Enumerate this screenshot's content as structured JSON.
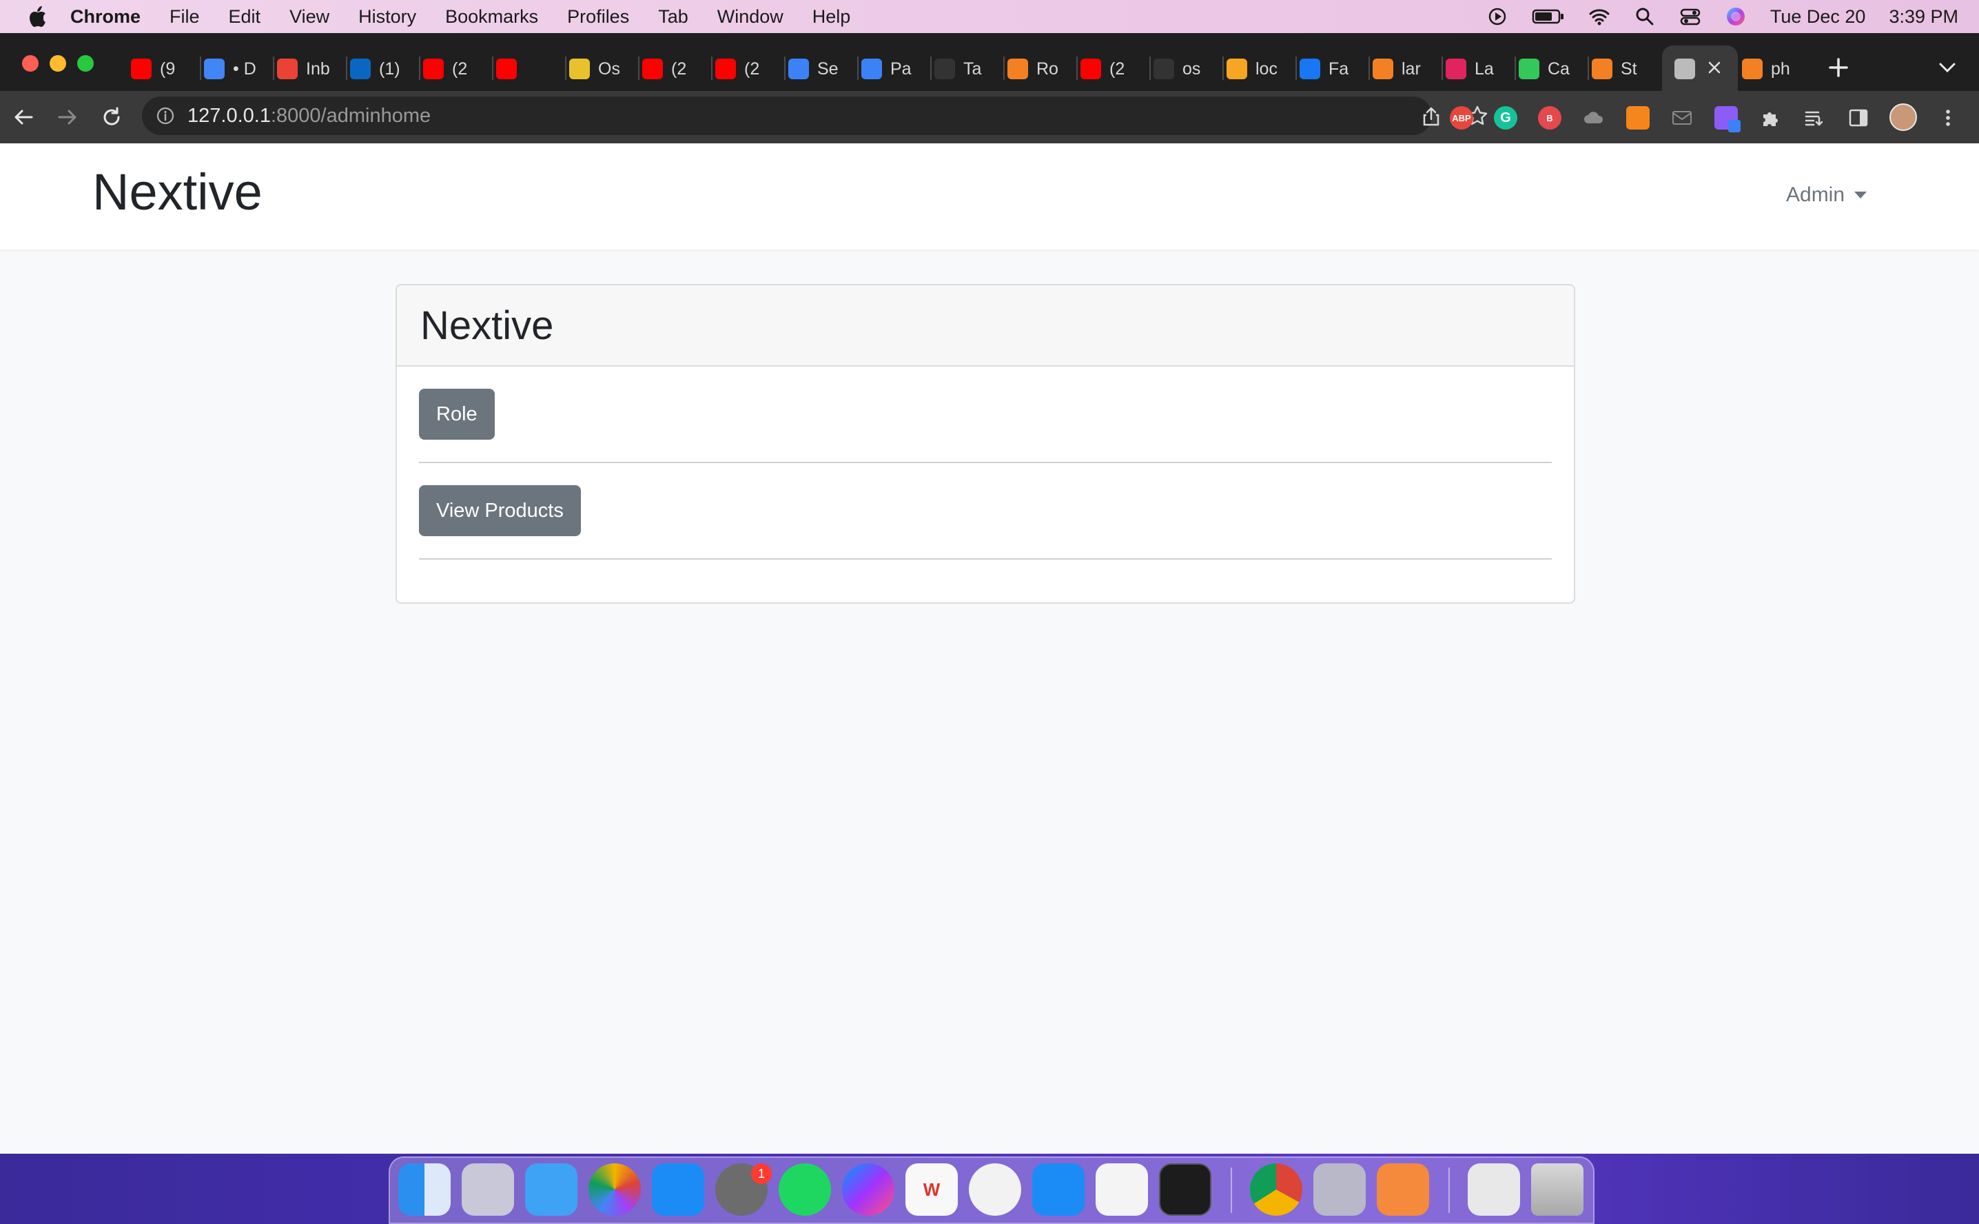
{
  "menubar": {
    "app_name": "Chrome",
    "items": [
      "File",
      "Edit",
      "View",
      "History",
      "Bookmarks",
      "Profiles",
      "Tab",
      "Window",
      "Help"
    ],
    "date": "Tue Dec 20",
    "time": "3:39 PM"
  },
  "tabs": [
    {
      "label": "(9",
      "icon": "youtube-icon",
      "color": "#ff0000"
    },
    {
      "label": "• D",
      "icon": "google-icon",
      "color": "#4285f4"
    },
    {
      "label": "Inb",
      "icon": "gmail-icon",
      "color": "#ea4335"
    },
    {
      "label": "(1)",
      "icon": "linkedin-icon",
      "color": "#0a66c2"
    },
    {
      "label": "(2",
      "icon": "youtube-icon",
      "color": "#ff0000"
    },
    {
      "label": "",
      "icon": "youtube-icon",
      "color": "#ff0000"
    },
    {
      "label": "Os",
      "icon": "circle-icon",
      "color": "#e8c22a"
    },
    {
      "label": "(2",
      "icon": "youtube-icon",
      "color": "#ff0000"
    },
    {
      "label": "(2",
      "icon": "youtube-icon",
      "color": "#ff0000"
    },
    {
      "label": "Se",
      "icon": "leaf-icon",
      "color": "#3b82f6"
    },
    {
      "label": "Pa",
      "icon": "leaf-icon",
      "color": "#3b82f6"
    },
    {
      "label": "Ta",
      "icon": "github-icon",
      "color": "#333333"
    },
    {
      "label": "Ro",
      "icon": "stack-icon",
      "color": "#f48024"
    },
    {
      "label": "(2",
      "icon": "youtube-icon",
      "color": "#ff0000"
    },
    {
      "label": "os",
      "icon": "github-icon",
      "color": "#333333"
    },
    {
      "label": "loc",
      "icon": "tent-icon",
      "color": "#f6a623"
    },
    {
      "label": "Fa",
      "icon": "facebook-icon",
      "color": "#1877f2"
    },
    {
      "label": "lar",
      "icon": "stack-icon",
      "color": "#f48024"
    },
    {
      "label": "La",
      "icon": "laracasts-icon",
      "color": "#e0245e"
    },
    {
      "label": "Ca",
      "icon": "refresh-icon",
      "color": "#34c759"
    },
    {
      "label": "St",
      "icon": "stack-icon",
      "color": "#f48024"
    },
    {
      "label": "",
      "icon": "globe-icon",
      "color": "#bbbbbb"
    },
    {
      "label": "ph",
      "icon": "stack-icon",
      "color": "#f48024"
    }
  ],
  "address": {
    "host": "127.0.0.1",
    "path": ":8000/adminhome"
  },
  "extensions": [
    "ABP",
    "G",
    "B",
    "",
    "",
    "",
    "",
    "",
    "",
    "",
    ""
  ],
  "navbar": {
    "brand": "Nextive",
    "user_menu": "Admin"
  },
  "card": {
    "title": "Nextive",
    "buttons": [
      "Role",
      "View Products"
    ]
  },
  "dock": {
    "settings_badge": "1"
  }
}
